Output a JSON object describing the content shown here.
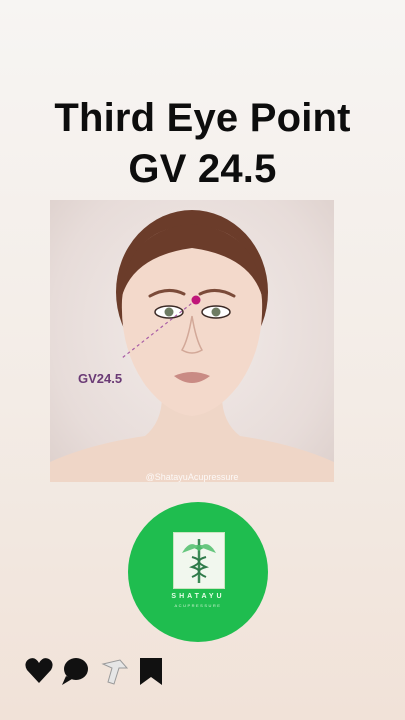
{
  "title": {
    "line1": "Third Eye Point",
    "line2": "GV 24.5"
  },
  "image": {
    "point_label": "GV24.5",
    "watermark": "@ShatayuAcupressure"
  },
  "logo": {
    "brand": "SHATAYU",
    "subtitle": "ACUPRESSURE",
    "circle_color": "#1fbd4f"
  },
  "actions": {
    "icons": [
      "heart-icon",
      "comment-icon",
      "share-icon",
      "bookmark-icon"
    ]
  }
}
